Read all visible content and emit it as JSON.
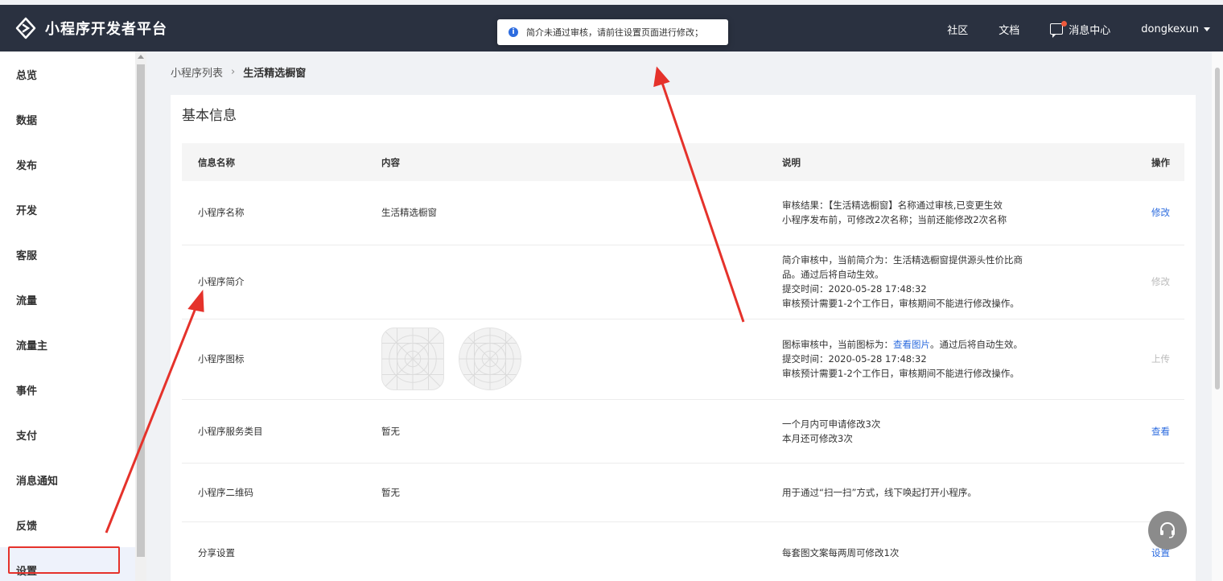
{
  "brand": {
    "title": "小程序开发者平台",
    "logo_icon": "miniprogram-logo-icon"
  },
  "toast": {
    "icon": "info-icon",
    "text": "简介未通过审核，请前往设置页面进行修改；"
  },
  "topnav": {
    "community": "社区",
    "docs": "文档",
    "messages": "消息中心",
    "user": "dongkexun"
  },
  "sidebar": {
    "items": [
      {
        "label": "总览"
      },
      {
        "label": "数据"
      },
      {
        "label": "发布"
      },
      {
        "label": "开发"
      },
      {
        "label": "客服"
      },
      {
        "label": "流量"
      },
      {
        "label": "流量主"
      },
      {
        "label": "事件"
      },
      {
        "label": "支付"
      },
      {
        "label": "消息通知"
      },
      {
        "label": "反馈"
      },
      {
        "label": "设置"
      }
    ]
  },
  "breadcrumb": {
    "parent": "小程序列表",
    "current": "生活精选橱窗"
  },
  "card": {
    "title": "基本信息",
    "headers": {
      "name": "信息名称",
      "content": "内容",
      "desc": "说明",
      "action": "操作"
    },
    "rows": [
      {
        "name": "小程序名称",
        "content": "生活精选橱窗",
        "desc": [
          "审核结果：【生活精选橱窗】名称通过审核,已变更生效",
          "小程序发布前，可修改2次名称；当前还能修改2次名称"
        ],
        "action": "修改"
      },
      {
        "name": "小程序简介",
        "content": "",
        "desc": [
          "简介审核中，当前简介为：生活精选橱窗提供源头性价比商",
          "品。通过后将自动生效。",
          "提交时间：2020-05-28 17:48:32",
          "审核预计需要1-2个工作日，审核期间不能进行修改操作。"
        ],
        "action": "修改"
      },
      {
        "name": "小程序图标",
        "content": "",
        "desc_prefix": "图标审核中，当前图标为：",
        "desc_link": "查看图片",
        "desc_suffix": "。通过后将自动生效。",
        "desc": [
          "提交时间：2020-05-28 17:48:32",
          "审核预计需要1-2个工作日，审核期间不能进行修改操作。"
        ],
        "action": "上传"
      },
      {
        "name": "小程序服务类目",
        "content": "暂无",
        "desc": [
          "一个月内可申请修改3次",
          "本月还可修改3次"
        ],
        "action": "查看"
      },
      {
        "name": "小程序二维码",
        "content": "暂无",
        "desc": [
          "用于通过“扫一扫”方式，线下唤起打开小程序。"
        ],
        "action": ""
      },
      {
        "name": "分享设置",
        "content": "",
        "desc": [
          "每套图文案每两周可修改1次"
        ],
        "action": "设置"
      }
    ]
  },
  "fab": {
    "icon": "customer-service-icon"
  },
  "colors": {
    "header_bg": "#2a3140",
    "link": "#2d6cdf",
    "annotation": "#e5322b"
  }
}
